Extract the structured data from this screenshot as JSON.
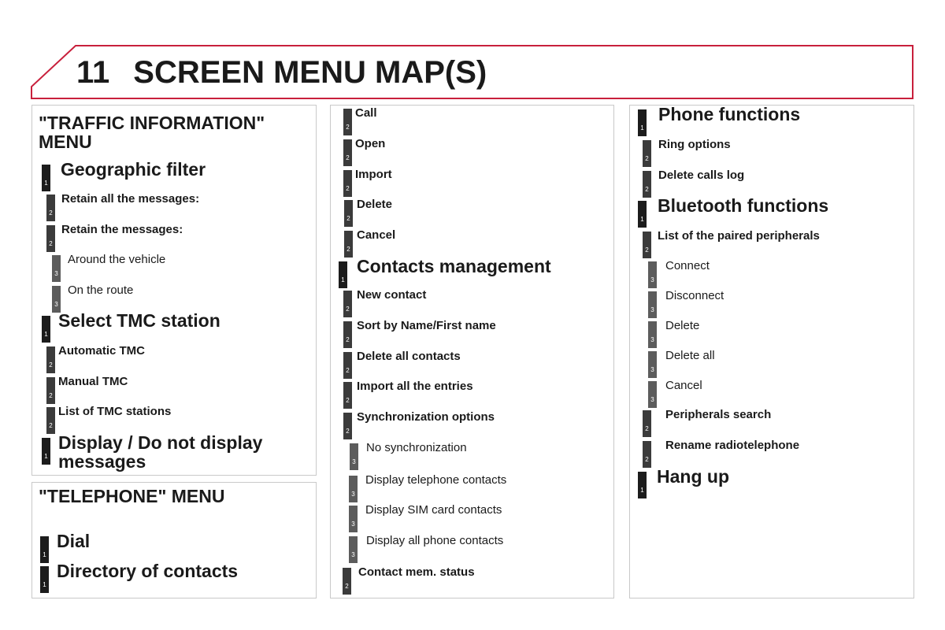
{
  "header": {
    "chapter_number": "11",
    "title": "SCREEN MENU MAP(S)",
    "accent_color": "#c8203c"
  },
  "traffic_menu": {
    "heading_line1": "\"TRAFFIC INFORMATION\"",
    "heading_line2": "MENU",
    "items": [
      {
        "level": 1,
        "label": "Geographic filter"
      },
      {
        "level": 2,
        "label": "Retain all the messages:"
      },
      {
        "level": 2,
        "label": "Retain the messages:"
      },
      {
        "level": 3,
        "label": "Around the vehicle"
      },
      {
        "level": 3,
        "label": "On the route"
      },
      {
        "level": 1,
        "label": "Select TMC station"
      },
      {
        "level": 2,
        "label": "Automatic TMC"
      },
      {
        "level": 2,
        "label": "Manual TMC"
      },
      {
        "level": 2,
        "label": "List of TMC stations"
      },
      {
        "level": 1,
        "label_line1": "Display / Do not display",
        "label_line2": "messages"
      }
    ]
  },
  "telephone_menu": {
    "heading": "\"TELEPHONE\" MENU",
    "items": [
      {
        "level": 1,
        "label": "Dial"
      },
      {
        "level": 1,
        "label": "Directory of contacts"
      }
    ]
  },
  "middle_column": {
    "items": [
      {
        "level": 2,
        "label": "Call"
      },
      {
        "level": 2,
        "label": "Open"
      },
      {
        "level": 2,
        "label": "Import"
      },
      {
        "level": 2,
        "label": "Delete"
      },
      {
        "level": 2,
        "label": "Cancel"
      },
      {
        "level": 1,
        "label": "Contacts management"
      },
      {
        "level": 2,
        "label": "New contact"
      },
      {
        "level": 2,
        "label": "Sort by Name/First name"
      },
      {
        "level": 2,
        "label": "Delete all contacts"
      },
      {
        "level": 2,
        "label": "Import all the entries"
      },
      {
        "level": 2,
        "label": "Synchronization options"
      },
      {
        "level": 3,
        "label": "No synchronization"
      },
      {
        "level": 3,
        "label": "Display telephone contacts"
      },
      {
        "level": 3,
        "label": "Display SIM card contacts"
      },
      {
        "level": 3,
        "label": "Display all phone contacts"
      },
      {
        "level": 2,
        "label": "Contact mem. status"
      }
    ]
  },
  "right_column": {
    "items": [
      {
        "level": 1,
        "label": "Phone functions"
      },
      {
        "level": 2,
        "label": "Ring options"
      },
      {
        "level": 2,
        "label": "Delete calls log"
      },
      {
        "level": 1,
        "label": "Bluetooth functions"
      },
      {
        "level": 2,
        "label": "List of the paired peripherals"
      },
      {
        "level": 3,
        "label": "Connect"
      },
      {
        "level": 3,
        "label": "Disconnect"
      },
      {
        "level": 3,
        "label": "Delete"
      },
      {
        "level": 3,
        "label": "Delete all"
      },
      {
        "level": 3,
        "label": "Cancel"
      },
      {
        "level": 2,
        "label": "Peripherals search"
      },
      {
        "level": 2,
        "label": "Rename radiotelephone"
      },
      {
        "level": 1,
        "label": "Hang up"
      }
    ]
  }
}
